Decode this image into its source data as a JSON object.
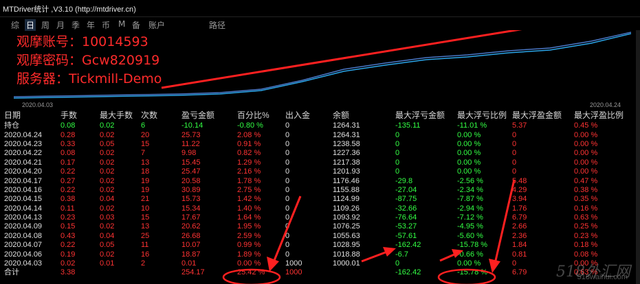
{
  "window": {
    "title": "MTDriver统计 ,V3.10 (http://mtdriver.cn)"
  },
  "toolbar": {
    "items": [
      "综",
      "日",
      "周",
      "月",
      "季",
      "年",
      "币",
      "M",
      "备",
      "账户",
      "路径"
    ],
    "active_index": 1
  },
  "account_info": {
    "line1": "观摩账号：10014593",
    "line2": "观摩密码：Gcw820919",
    "line3": "服务器：Tickmill-Demo"
  },
  "chart": {
    "start_date": "2020.04.03",
    "end_date": "2020.04.24",
    "line_color": "#2ba6ea",
    "line_color_2": "#4a78c8"
  },
  "table": {
    "headers": [
      "日期",
      "手数",
      "最大手数",
      "次数",
      "盈亏金额",
      "百分比%",
      "出入金",
      "余额",
      "最大浮亏金额",
      "最大浮亏比例",
      "最大浮盈金额",
      "最大浮盈比例"
    ],
    "position_row": [
      "持仓",
      "0.08",
      "0.02",
      "6",
      "-10.14",
      "-0.80 %",
      "0",
      "1264.31",
      "-135.11",
      "-11.01 %",
      "5.37",
      "0.45 %"
    ],
    "rows": [
      [
        "2020.04.24",
        "0.28",
        "0.02",
        "20",
        "25.73",
        "2.08 %",
        "0",
        "1264.31",
        "0",
        "0.00 %",
        "0",
        "0.00 %"
      ],
      [
        "2020.04.23",
        "0.33",
        "0.05",
        "15",
        "11.22",
        "0.91 %",
        "0",
        "1238.58",
        "0",
        "0.00 %",
        "0",
        "0.00 %"
      ],
      [
        "2020.04.22",
        "0.08",
        "0.02",
        "7",
        "9.98",
        "0.82 %",
        "0",
        "1227.36",
        "0",
        "0.00 %",
        "0",
        "0.00 %"
      ],
      [
        "2020.04.21",
        "0.17",
        "0.02",
        "13",
        "15.45",
        "1.29 %",
        "0",
        "1217.38",
        "0",
        "0.00 %",
        "0",
        "0.00 %"
      ],
      [
        "2020.04.20",
        "0.22",
        "0.02",
        "18",
        "25.47",
        "2.16 %",
        "0",
        "1201.93",
        "0",
        "0.00 %",
        "0",
        "0.00 %"
      ],
      [
        "2020.04.17",
        "0.27",
        "0.02",
        "19",
        "20.58",
        "1.78 %",
        "0",
        "1176.46",
        "-29.8",
        "-2.56 %",
        "5.48",
        "0.47 %"
      ],
      [
        "2020.04.16",
        "0.22",
        "0.02",
        "19",
        "30.89",
        "2.75 %",
        "0",
        "1155.88",
        "-27.04",
        "-2.34 %",
        "4.29",
        "0.38 %"
      ],
      [
        "2020.04.15",
        "0.38",
        "0.04",
        "21",
        "15.73",
        "1.42 %",
        "0",
        "1124.99",
        "-87.75",
        "-7.87 %",
        "3.94",
        "0.35 %"
      ],
      [
        "2020.04.14",
        "0.11",
        "0.02",
        "10",
        "15.34",
        "1.40 %",
        "0",
        "1109.26",
        "-32.66",
        "-2.94 %",
        "1.76",
        "0.16 %"
      ],
      [
        "2020.04.13",
        "0.23",
        "0.03",
        "15",
        "17.67",
        "1.64 %",
        "0",
        "1093.92",
        "-76.64",
        "-7.12 %",
        "6.79",
        "0.63 %"
      ],
      [
        "2020.04.09",
        "0.15",
        "0.02",
        "13",
        "20.62",
        "1.95 %",
        "0",
        "1076.25",
        "-53.27",
        "-4.95 %",
        "2.66",
        "0.25 %"
      ],
      [
        "2020.04.08",
        "0.43",
        "0.04",
        "25",
        "26.68",
        "2.59 %",
        "0",
        "1055.63",
        "-57.61",
        "-5.60 %",
        "2.36",
        "0.23 %"
      ],
      [
        "2020.04.07",
        "0.22",
        "0.05",
        "11",
        "10.07",
        "0.99 %",
        "0",
        "1028.95",
        "-162.42",
        "-15.78 %",
        "1.84",
        "0.18 %"
      ],
      [
        "2020.04.06",
        "0.19",
        "0.02",
        "16",
        "18.87",
        "1.89 %",
        "0",
        "1018.88",
        "-6.7",
        "-0.66 %",
        "0.81",
        "0.08 %"
      ],
      [
        "2020.04.03",
        "0.02",
        "0.01",
        "2",
        "0.01",
        "0.00 %",
        "1000",
        "1000.01",
        "0",
        "0.00 %",
        "0",
        "0.00 %"
      ]
    ],
    "total_row": [
      "合计",
      "3.38",
      "",
      "",
      "254.17",
      "25.42 %",
      "1000",
      "",
      "-162.42",
      "-15.78 %",
      "6.79",
      "0.63 %"
    ]
  },
  "watermark": {
    "text": "518外汇网",
    "url": "518waihui.com"
  }
}
